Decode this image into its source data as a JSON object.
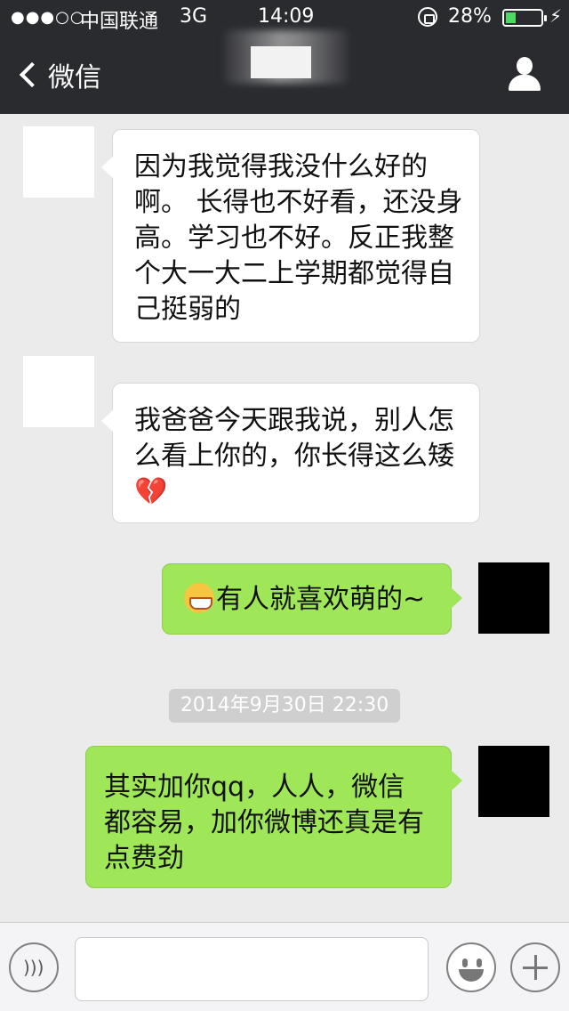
{
  "status_bar": {
    "signal": "●●●○○",
    "carrier": "中国联通",
    "network": "3G",
    "time": "14:09",
    "battery_percent": "28%",
    "battery_level": 0.28
  },
  "nav": {
    "back_label": "微信"
  },
  "messages": [
    {
      "from": "them",
      "text": "因为我觉得我没什么好的啊。 长得也不好看，还没身高。学习也不好。反正我整个大一大二上学期都觉得自己挺弱的"
    },
    {
      "from": "them",
      "text": "我爸爸今天跟我说，别人怎么看上你的，你长得这么矮",
      "emoji": "broken-heart-icon"
    },
    {
      "from": "me",
      "text": "有人就喜欢萌的~",
      "emoji": "grinning-face-icon"
    },
    {
      "from": "me",
      "text": "其实加你qq，人人，微信都容易，加你微博还真是有点费劲"
    }
  ],
  "timestamp": "2014年9月30日 22:30",
  "input_bar": {
    "placeholder": ""
  },
  "colors": {
    "nav_bg": "#2a2b2f",
    "chat_bg": "#ebebeb",
    "outgoing_bubble": "#9fe658",
    "incoming_bubble": "#ffffff"
  }
}
